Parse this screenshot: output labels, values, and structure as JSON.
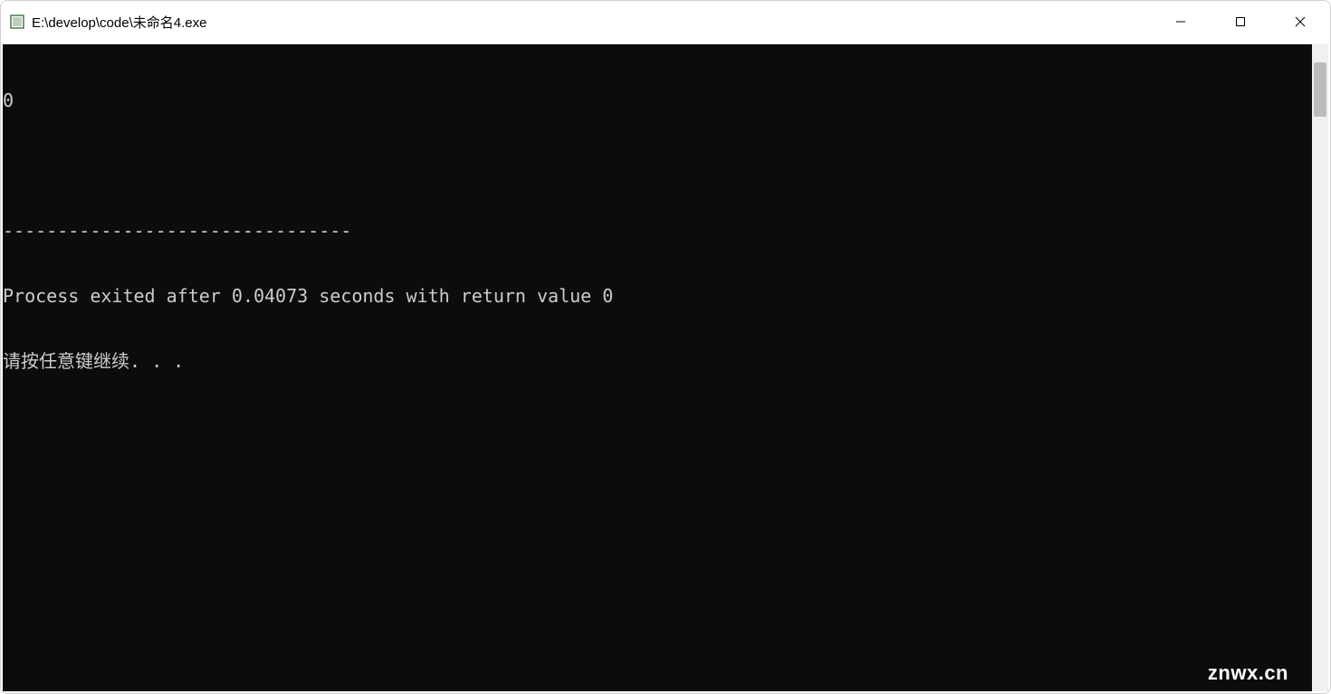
{
  "window": {
    "title": "E:\\develop\\code\\未命名4.exe"
  },
  "console": {
    "lines": [
      "0",
      "",
      "--------------------------------",
      "Process exited after 0.04073 seconds with return value 0",
      "请按任意键继续. . ."
    ]
  },
  "watermark": "znwx.cn"
}
